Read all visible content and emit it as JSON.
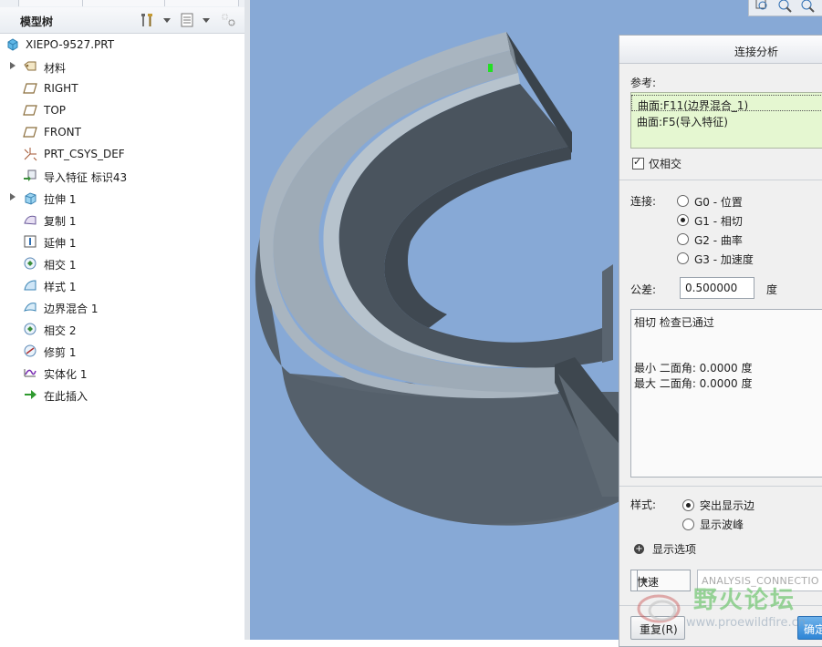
{
  "model_tree": {
    "title": "模型树",
    "items": [
      {
        "label": "XIEPO-9527.PRT",
        "icon": "part-icon",
        "expandable": false,
        "root": true
      },
      {
        "label": "材料",
        "icon": "material-icon",
        "expandable": true
      },
      {
        "label": "RIGHT",
        "icon": "datum-plane-icon",
        "expandable": false
      },
      {
        "label": "TOP",
        "icon": "datum-plane-icon",
        "expandable": false
      },
      {
        "label": "FRONT",
        "icon": "datum-plane-icon",
        "expandable": false
      },
      {
        "label": "PRT_CSYS_DEF",
        "icon": "csys-icon",
        "expandable": false
      },
      {
        "label": "导入特征 标识43",
        "icon": "import-feature-icon",
        "expandable": false
      },
      {
        "label": "拉伸 1",
        "icon": "extrude-icon",
        "expandable": true
      },
      {
        "label": "复制 1",
        "icon": "copy-icon",
        "expandable": false
      },
      {
        "label": "延伸 1",
        "icon": "extend-icon",
        "expandable": false
      },
      {
        "label": "相交 1",
        "icon": "intersect-icon",
        "expandable": false
      },
      {
        "label": "样式 1",
        "icon": "style-icon",
        "expandable": false
      },
      {
        "label": "边界混合 1",
        "icon": "boundary-blend-icon",
        "expandable": false
      },
      {
        "label": "相交 2",
        "icon": "intersect-icon",
        "expandable": false
      },
      {
        "label": "修剪 1",
        "icon": "trim-icon",
        "expandable": false
      },
      {
        "label": "实体化 1",
        "icon": "solidify-icon",
        "expandable": false
      },
      {
        "label": "在此插入",
        "icon": "insert-here-arrow-icon",
        "expandable": false
      }
    ]
  },
  "dialog": {
    "title": "连接分析",
    "reference_label": "参考:",
    "references": [
      "曲面:F11(边界混合_1)",
      "曲面:F5(导入特征)"
    ],
    "only_intersect_label": "仅相交",
    "only_intersect_checked": true,
    "connection_label": "连接:",
    "connection_options": [
      {
        "label": "G0 - 位置",
        "selected": false
      },
      {
        "label": "G1 - 相切",
        "selected": true
      },
      {
        "label": "G2 - 曲率",
        "selected": false
      },
      {
        "label": "G3 - 加速度",
        "selected": false
      }
    ],
    "tolerance_label": "公差:",
    "tolerance_value": "0.500000",
    "tolerance_unit": "度",
    "result_lines": [
      "相切 检查已通过",
      "最小 二面角: 0.0000 度",
      "最大 二面角: 0.0000 度"
    ],
    "style_label": "样式:",
    "style_options": [
      {
        "label": "突出显示边",
        "selected": true
      },
      {
        "label": "显示波峰",
        "selected": false
      }
    ],
    "display_options_label": "显示选项",
    "mode_value": "快速",
    "analysis_name": "ANALYSIS_CONNECTIO",
    "repeat_button": "重复(R)",
    "ok_button": "确定"
  },
  "watermark": {
    "text": "野火论坛",
    "url": "www.proewildfire.cn"
  },
  "colors": {
    "viewport_bg": "#87a9d6",
    "model_dark": "#4f5a65",
    "model_light": "#a5b2bd",
    "reference_bg": "#e5f7d1",
    "ok_button": "#2f86d6"
  }
}
